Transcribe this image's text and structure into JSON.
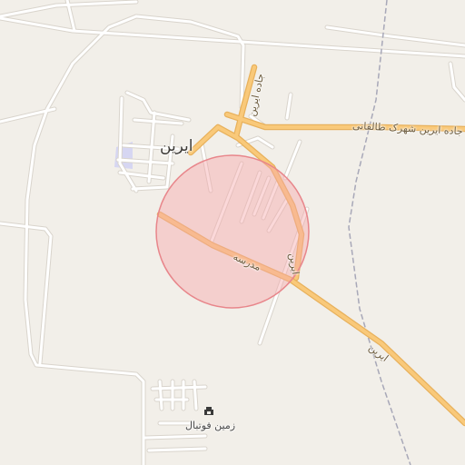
{
  "map": {
    "labels": {
      "town": "ایرین",
      "road_north": "جاده ایرین",
      "road_east": "جاده ایرین شهرک طالقانی",
      "street_madreseh": "مدرسه",
      "street_irin_vertical": "ایرین",
      "street_irin_southeast": "ایرین",
      "poi_football": "زمین فوتبال"
    },
    "icons": {
      "poi_football": "stadium-icon"
    },
    "colors": {
      "background": "#f2efe9",
      "major_road": "#f9c97a",
      "major_road_casing": "#e8b15c",
      "minor_road": "#ffffff",
      "minor_road_casing": "#d9d4cc",
      "railway": "#a8a8b8",
      "highlight_fill": "#f7a8ab",
      "highlight_stroke": "#e8868b",
      "landuse": "#d6d6f2"
    }
  }
}
